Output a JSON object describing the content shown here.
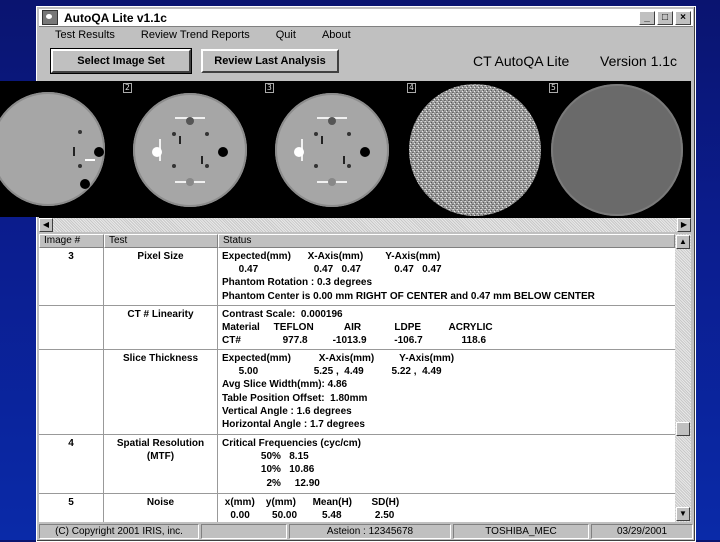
{
  "window": {
    "title": "AutoQA  Lite  v1.1c",
    "controls": [
      "_",
      "□",
      "×"
    ]
  },
  "menu": [
    "Test Results",
    "Review Trend Reports",
    "Quit",
    "About"
  ],
  "toolbar": {
    "select_button": "Select Image Set",
    "review_button": "Review Last Analysis",
    "product_name": "CT AutoQA Lite",
    "version": "Version 1.1c"
  },
  "thumbnails": [
    {
      "label": "",
      "kind": "phantom-partial"
    },
    {
      "label": "2",
      "kind": "phantom"
    },
    {
      "label": "3",
      "kind": "phantom"
    },
    {
      "label": "4",
      "kind": "noise"
    },
    {
      "label": "5",
      "kind": "uniform"
    }
  ],
  "table": {
    "headers": [
      "Image #",
      "Test",
      "Status"
    ],
    "rows": [
      {
        "image": "3",
        "test": "Pixel Size",
        "lines": [
          "Expected(mm)      X-Axis(mm)        Y-Axis(mm)",
          "      0.47                    0.47   0.47            0.47   0.47",
          "Phantom Rotation : 0.3 degrees",
          "Phantom Center is 0.00 mm RIGHT OF CENTER and 0.47 mm BELOW CENTER"
        ]
      },
      {
        "image": "",
        "test": "CT # Linearity",
        "lines": [
          "Contrast Scale:  0.000196",
          "Material     TEFLON           AIR            LDPE          ACRYLIC",
          "CT#               977.8         -1013.9          -106.7              118.6"
        ]
      },
      {
        "image": "",
        "test": "Slice Thickness",
        "lines": [
          "Expected(mm)          X-Axis(mm)         Y-Axis(mm)",
          "      5.00                    5.25 ,  4.49          5.22 ,  4.49",
          "Avg Slice Width(mm): 4.86",
          "Table Position Offset:  1.80mm",
          "Vertical Angle : 1.6 degrees",
          "Horizontal Angle : 1.7 degrees"
        ]
      },
      {
        "image": "4",
        "test": "Spatial Resolution",
        "test2": "(MTF)",
        "lines": [
          "Critical Frequencies (cyc/cm)",
          "              50%   8.15",
          "              10%   10.86",
          "                2%     12.90"
        ]
      },
      {
        "image": "5",
        "test": "Noise",
        "lines": [
          " x(mm)    y(mm)      Mean(H)       SD(H)",
          "   0.00        50.00         5.48            2.50"
        ]
      }
    ]
  },
  "status_bar": [
    "(C) Copyright 2001  IRIS, inc.",
    "",
    "Asteion :  12345678",
    "TOSHIBA_MEC",
    "03/29/2001"
  ]
}
